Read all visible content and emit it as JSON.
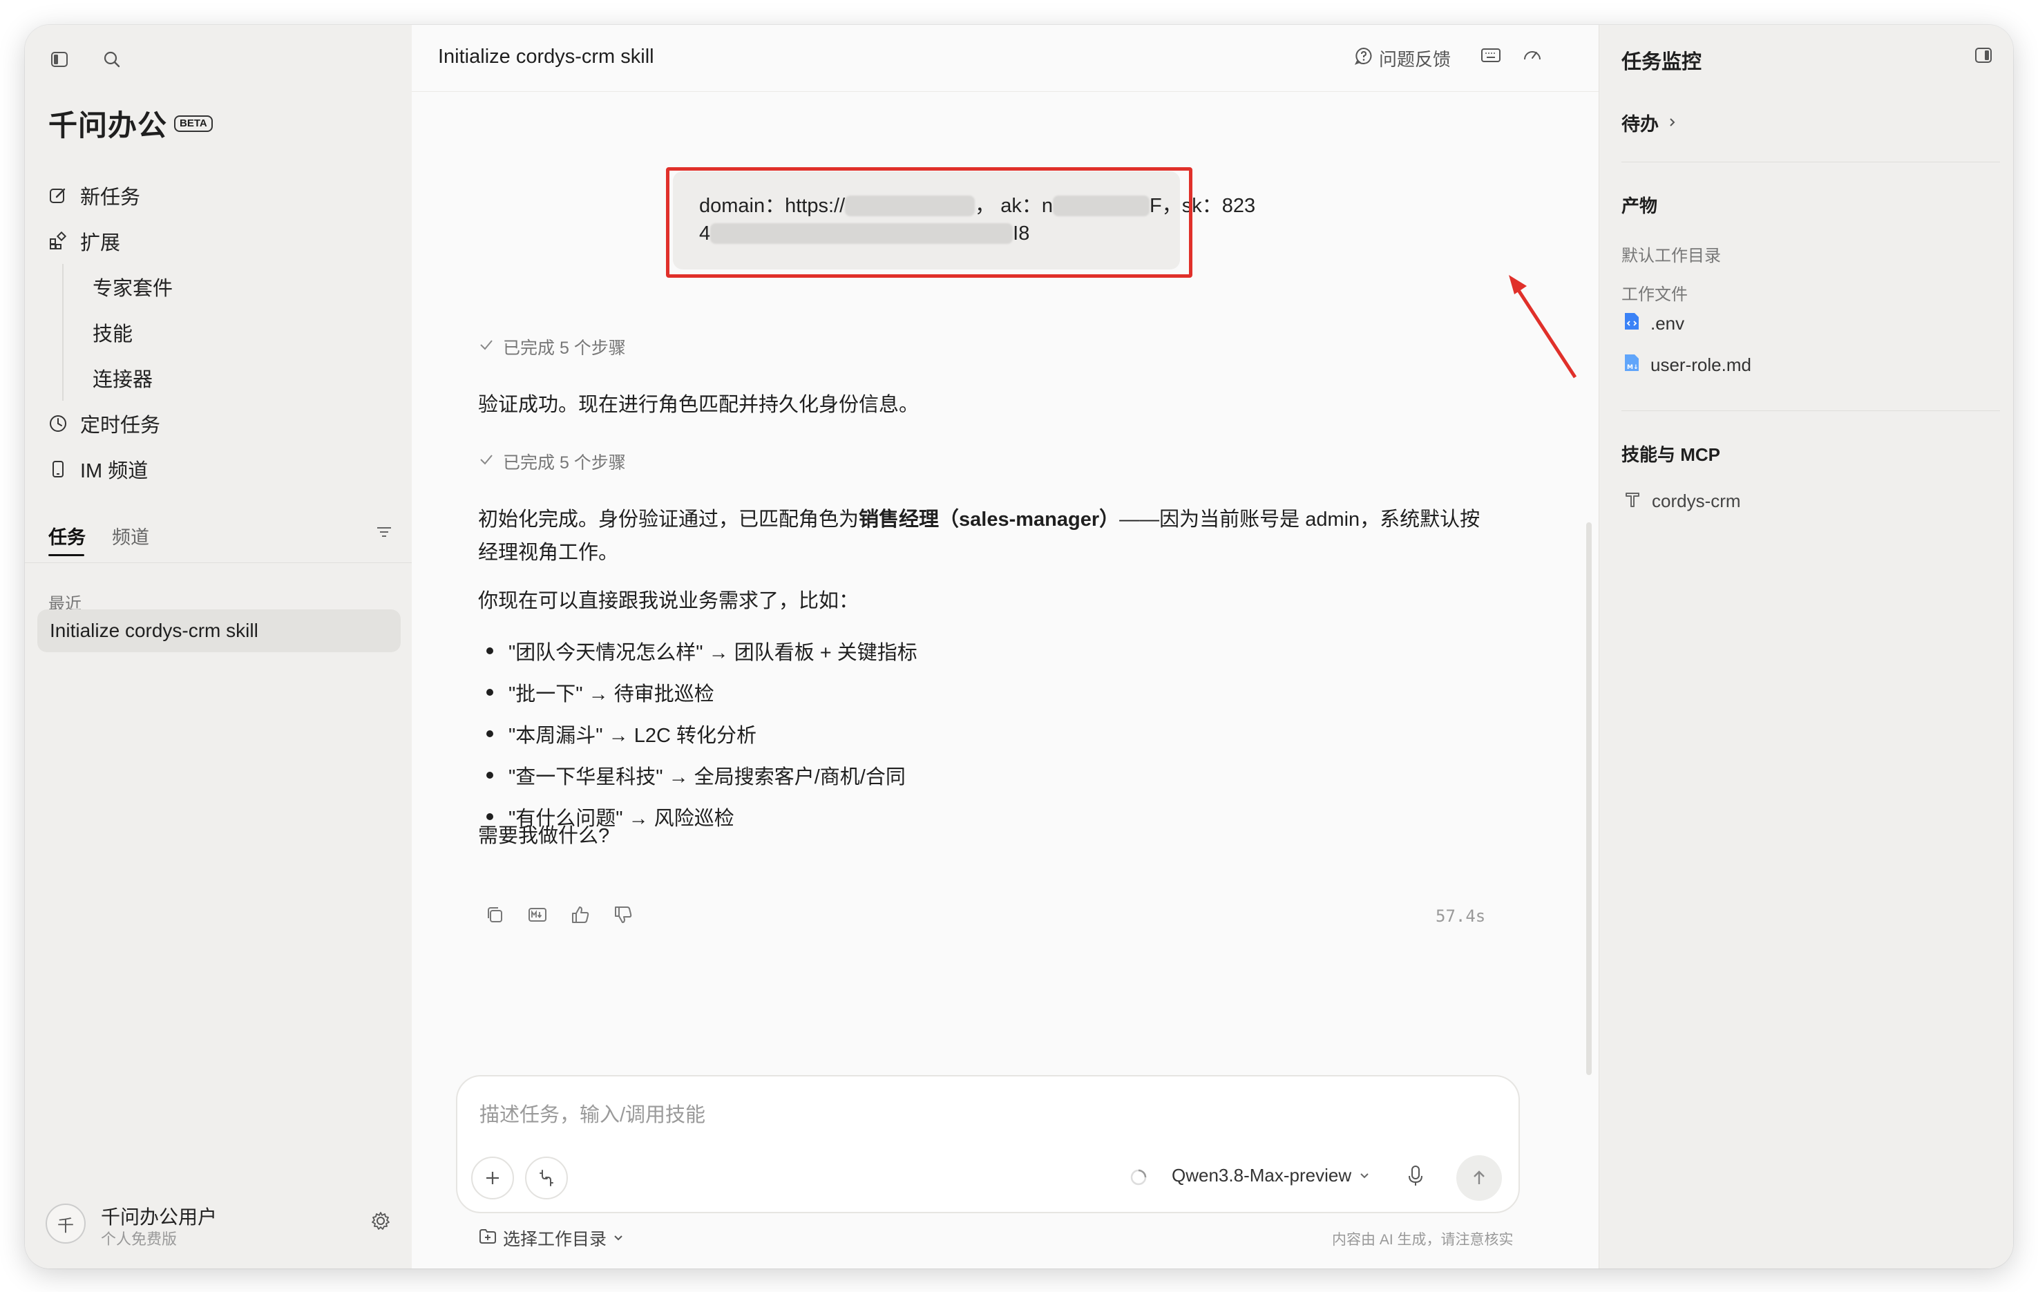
{
  "sidebar": {
    "brand": "千问办公",
    "beta_badge": "BETA",
    "nav": {
      "new_task": "新任务",
      "extensions": "扩展",
      "expert_suite": "专家套件",
      "skills": "技能",
      "connectors": "连接器",
      "scheduled": "定时任务",
      "im_channel": "IM 频道"
    },
    "tabs": {
      "tasks": "任务",
      "channels": "频道"
    },
    "recent_label": "最近",
    "recent_task": "Initialize cordys-crm skill",
    "user": {
      "avatar_char": "千",
      "name": "千问办公用户",
      "plan": "个人免费版"
    }
  },
  "main": {
    "title": "Initialize cordys-crm skill",
    "feedback": "问题反馈",
    "user_message": {
      "domain_label": "domain：https://",
      "ak_label": "，  ak：n",
      "ak_tail": "F，sk：823",
      "line2_head": "4",
      "line2_tail": "I8"
    },
    "steps1": "已完成 5 个步骤",
    "verify_text": "验证成功。现在进行角色匹配并持久化身份信息。",
    "steps2": "已完成 5 个步骤",
    "init_text_a": "初始化完成。身份验证通过，已匹配角色为",
    "init_text_bold": "销售经理（sales-manager）",
    "init_text_b": "——因为当前账号是 admin，系统默认按经理视角工作。",
    "now_text": "你现在可以直接跟我说业务需求了，比如：",
    "bullets": [
      "\"团队今天情况怎么样\" → 团队看板 + 关键指标",
      "\"批一下\" → 待审批巡检",
      "\"本周漏斗\" → L2C 转化分析",
      "\"查一下华星科技\" → 全局搜索客户/商机/合同",
      "\"有什么问题\" → 风险巡检"
    ],
    "question": "需要我做什么?",
    "elapsed": "57.4s",
    "input_placeholder": "描述任务，输入/调用技能",
    "model": "Qwen3.8-Max-preview",
    "workdir": "选择工作目录",
    "disclaimer": "内容由 AI 生成，请注意核实"
  },
  "right_panel": {
    "title": "任务监控",
    "todo": "待办",
    "artifacts": "产物",
    "default_dir": "默认工作目录",
    "work_files": "工作文件",
    "files": [
      ".env",
      "user-role.md"
    ],
    "skills_mcp": "技能与 MCP",
    "skill": "cordys-crm"
  },
  "colors": {
    "highlight_box": "#e0302a",
    "file_icon": "#3b82f6"
  }
}
